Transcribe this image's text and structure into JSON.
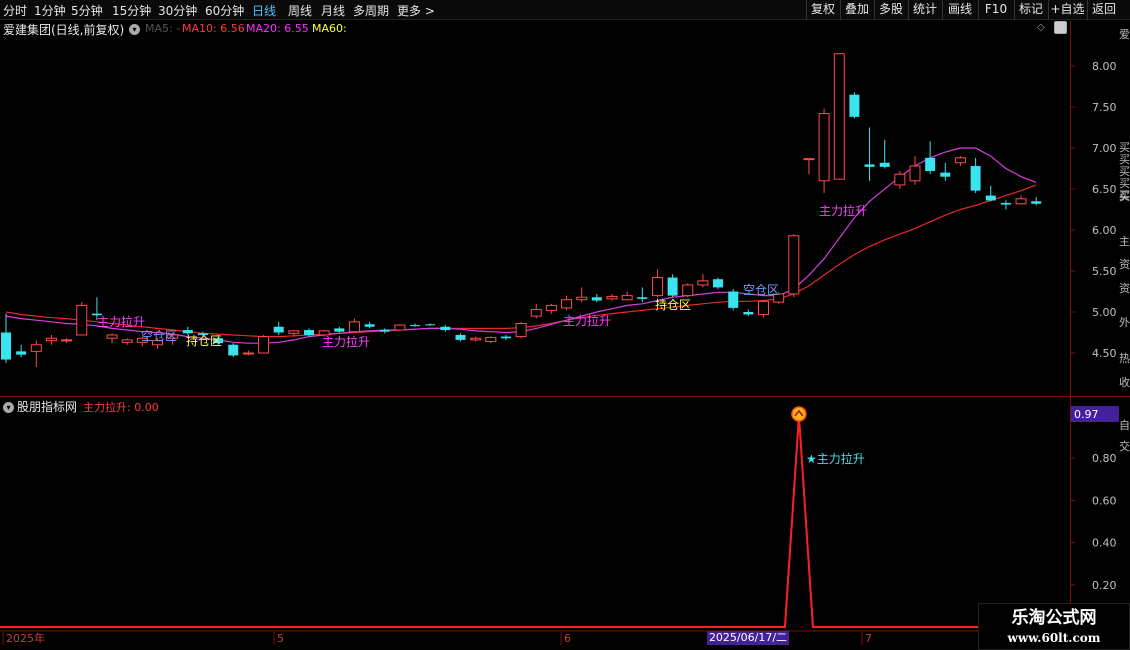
{
  "toolbar": {
    "timeframes": [
      "分时",
      "1分钟",
      "5分钟",
      "15分钟",
      "30分钟",
      "60分钟",
      "日线",
      "周线",
      "月线",
      "多周期",
      "更多 >"
    ],
    "active": "日线",
    "right_buttons": [
      "复权",
      "叠加",
      "多股",
      "统计",
      "画线",
      "F10",
      "标记",
      "+自选",
      "返回"
    ]
  },
  "main_header": {
    "stock_title": "爱建集团(日线,前复权)",
    "ma5": "MA5: -",
    "ma10": "MA10: 6.56",
    "ma20": "MA20: 6.55",
    "ma60": "MA60:",
    "colors": {
      "ma5": "#555555",
      "ma10": "#ff3a3a",
      "ma20": "#ff2bff",
      "ma60": "#ffff33"
    }
  },
  "indicator_header": {
    "name": "股朋指标网",
    "value": "主力拉升: 0.00"
  },
  "price_axis": [
    "8.00",
    "7.50",
    "7.00",
    "6.50",
    "6.00",
    "5.50",
    "5.00",
    "4.50"
  ],
  "indicator_axis": [
    "1.00",
    "0.80",
    "0.60",
    "0.40",
    "0.20"
  ],
  "indicator_current": "0.97",
  "time_axis": [
    "2025年",
    "5",
    "6",
    "7"
  ],
  "cursor_date": "2025/06/17/二",
  "chart_labels": {
    "lift": "主力拉升",
    "empty": "空仓区",
    "hold": "持仓区",
    "lift_star": "★主力拉升"
  },
  "side_strip": [
    "爱",
    "买买买买买",
    "买",
    "主",
    "资",
    "资",
    "外",
    "热",
    "收",
    "自",
    "交"
  ],
  "watermark": {
    "title": "乐淘公式网",
    "url": "www.60lt.com"
  },
  "chart_data": {
    "type": "candlestick",
    "ylim": [
      4.2,
      8.4
    ],
    "candles": [
      {
        "o": 4.75,
        "h": 4.98,
        "l": 4.38,
        "c": 4.42
      },
      {
        "o": 4.52,
        "h": 4.6,
        "l": 4.45,
        "c": 4.48
      },
      {
        "o": 4.52,
        "h": 4.65,
        "l": 4.33,
        "c": 4.6
      },
      {
        "o": 4.65,
        "h": 4.72,
        "l": 4.6,
        "c": 4.68
      },
      {
        "o": 4.65,
        "h": 4.68,
        "l": 4.62,
        "c": 4.66
      },
      {
        "o": 4.72,
        "h": 5.12,
        "l": 4.72,
        "c": 5.08
      },
      {
        "o": 4.98,
        "h": 5.18,
        "l": 4.9,
        "c": 4.96
      },
      {
        "o": 4.68,
        "h": 4.74,
        "l": 4.62,
        "c": 4.72
      },
      {
        "o": 4.63,
        "h": 4.68,
        "l": 4.6,
        "c": 4.66
      },
      {
        "o": 4.63,
        "h": 4.7,
        "l": 4.58,
        "c": 4.68
      },
      {
        "o": 4.6,
        "h": 4.68,
        "l": 4.55,
        "c": 4.65
      },
      {
        "o": 4.68,
        "h": 4.75,
        "l": 4.6,
        "c": 4.72
      },
      {
        "o": 4.78,
        "h": 4.82,
        "l": 4.72,
        "c": 4.74
      },
      {
        "o": 4.74,
        "h": 4.76,
        "l": 4.7,
        "c": 4.72
      },
      {
        "o": 4.68,
        "h": 4.72,
        "l": 4.6,
        "c": 4.62
      },
      {
        "o": 4.6,
        "h": 4.62,
        "l": 4.45,
        "c": 4.47
      },
      {
        "o": 4.5,
        "h": 4.53,
        "l": 4.47,
        "c": 4.5
      },
      {
        "o": 4.5,
        "h": 4.72,
        "l": 4.5,
        "c": 4.7
      },
      {
        "o": 4.82,
        "h": 4.88,
        "l": 4.72,
        "c": 4.75
      },
      {
        "o": 4.74,
        "h": 4.78,
        "l": 4.7,
        "c": 4.77
      },
      {
        "o": 4.78,
        "h": 4.8,
        "l": 4.7,
        "c": 4.72
      },
      {
        "o": 4.72,
        "h": 4.78,
        "l": 4.7,
        "c": 4.77
      },
      {
        "o": 4.8,
        "h": 4.82,
        "l": 4.75,
        "c": 4.76
      },
      {
        "o": 4.76,
        "h": 4.92,
        "l": 4.75,
        "c": 4.88
      },
      {
        "o": 4.85,
        "h": 4.88,
        "l": 4.8,
        "c": 4.82
      },
      {
        "o": 4.78,
        "h": 4.8,
        "l": 4.74,
        "c": 4.76
      },
      {
        "o": 4.78,
        "h": 4.85,
        "l": 4.78,
        "c": 4.84
      },
      {
        "o": 4.84,
        "h": 4.86,
        "l": 4.82,
        "c": 4.83
      },
      {
        "o": 4.85,
        "h": 4.86,
        "l": 4.83,
        "c": 4.84
      },
      {
        "o": 4.82,
        "h": 4.84,
        "l": 4.76,
        "c": 4.78
      },
      {
        "o": 4.72,
        "h": 4.74,
        "l": 4.64,
        "c": 4.66
      },
      {
        "o": 4.66,
        "h": 4.7,
        "l": 4.64,
        "c": 4.68
      },
      {
        "o": 4.64,
        "h": 4.7,
        "l": 4.62,
        "c": 4.69
      },
      {
        "o": 4.7,
        "h": 4.72,
        "l": 4.66,
        "c": 4.68
      },
      {
        "o": 4.7,
        "h": 4.88,
        "l": 4.68,
        "c": 4.86
      },
      {
        "o": 4.95,
        "h": 5.1,
        "l": 4.92,
        "c": 5.03
      },
      {
        "o": 5.02,
        "h": 5.1,
        "l": 4.98,
        "c": 5.08
      },
      {
        "o": 5.05,
        "h": 5.2,
        "l": 5.02,
        "c": 5.15
      },
      {
        "o": 5.15,
        "h": 5.3,
        "l": 5.12,
        "c": 5.18
      },
      {
        "o": 5.18,
        "h": 5.22,
        "l": 5.12,
        "c": 5.14
      },
      {
        "o": 5.16,
        "h": 5.22,
        "l": 5.14,
        "c": 5.19
      },
      {
        "o": 5.15,
        "h": 5.25,
        "l": 5.14,
        "c": 5.2
      },
      {
        "o": 5.18,
        "h": 5.3,
        "l": 5.12,
        "c": 5.16
      },
      {
        "o": 5.2,
        "h": 5.52,
        "l": 5.18,
        "c": 5.42
      },
      {
        "o": 5.42,
        "h": 5.46,
        "l": 5.18,
        "c": 5.2
      },
      {
        "o": 5.2,
        "h": 5.35,
        "l": 5.18,
        "c": 5.33
      },
      {
        "o": 5.33,
        "h": 5.46,
        "l": 5.3,
        "c": 5.38
      },
      {
        "o": 5.4,
        "h": 5.42,
        "l": 5.28,
        "c": 5.3
      },
      {
        "o": 5.25,
        "h": 5.28,
        "l": 5.02,
        "c": 5.05
      },
      {
        "o": 5.0,
        "h": 5.03,
        "l": 4.95,
        "c": 4.97
      },
      {
        "o": 4.97,
        "h": 5.15,
        "l": 4.93,
        "c": 5.13
      },
      {
        "o": 5.12,
        "h": 5.24,
        "l": 5.1,
        "c": 5.22
      },
      {
        "o": 5.22,
        "h": 5.95,
        "l": 5.18,
        "c": 5.93
      },
      {
        "o": 6.87,
        "h": 6.87,
        "l": 6.68,
        "c": 6.87
      },
      {
        "o": 6.6,
        "h": 7.48,
        "l": 6.45,
        "c": 7.42
      },
      {
        "o": 6.62,
        "h": 8.15,
        "l": 6.62,
        "c": 8.15
      },
      {
        "o": 7.65,
        "h": 7.68,
        "l": 7.36,
        "c": 7.38
      },
      {
        "o": 6.8,
        "h": 7.25,
        "l": 6.6,
        "c": 6.77
      },
      {
        "o": 6.82,
        "h": 7.1,
        "l": 6.75,
        "c": 6.77
      },
      {
        "o": 6.55,
        "h": 6.72,
        "l": 6.5,
        "c": 6.68
      },
      {
        "o": 6.6,
        "h": 6.9,
        "l": 6.55,
        "c": 6.78
      },
      {
        "o": 6.88,
        "h": 7.08,
        "l": 6.68,
        "c": 6.72
      },
      {
        "o": 6.7,
        "h": 6.82,
        "l": 6.6,
        "c": 6.65
      },
      {
        "o": 6.82,
        "h": 6.9,
        "l": 6.78,
        "c": 6.88
      },
      {
        "o": 6.78,
        "h": 6.88,
        "l": 6.45,
        "c": 6.48
      },
      {
        "o": 6.42,
        "h": 6.54,
        "l": 6.35,
        "c": 6.36
      },
      {
        "o": 6.33,
        "h": 6.36,
        "l": 6.25,
        "c": 6.31
      },
      {
        "o": 6.32,
        "h": 6.42,
        "l": 6.31,
        "c": 6.38
      },
      {
        "o": 6.35,
        "h": 6.4,
        "l": 6.3,
        "c": 6.32
      }
    ],
    "ma20": [
      4.95,
      4.92,
      4.9,
      4.88,
      4.86,
      4.85,
      4.83,
      4.8,
      4.78,
      4.76,
      4.75,
      4.73,
      4.7,
      4.68,
      4.66,
      4.63,
      4.62,
      4.62,
      4.63,
      4.66,
      4.7,
      4.72,
      4.74,
      4.76,
      4.77,
      4.78,
      4.78,
      4.79,
      4.8,
      4.8,
      4.79,
      4.77,
      4.76,
      4.75,
      4.76,
      4.8,
      4.85,
      4.9,
      4.95,
      5.0,
      5.04,
      5.08,
      5.1,
      5.14,
      5.18,
      5.2,
      5.22,
      5.24,
      5.24,
      5.22,
      5.2,
      5.2,
      5.28,
      5.45,
      5.65,
      5.9,
      6.15,
      6.35,
      6.5,
      6.65,
      6.78,
      6.88,
      6.95,
      7.0,
      7.0,
      6.9,
      6.75,
      6.65,
      6.58
    ],
    "ma10": [
      5.0,
      4.97,
      4.95,
      4.93,
      4.92,
      4.9,
      4.88,
      4.86,
      4.84,
      4.82,
      4.8,
      4.78,
      4.76,
      4.74,
      4.73,
      4.72,
      4.71,
      4.7,
      4.7,
      4.71,
      4.72,
      4.73,
      4.74,
      4.75,
      4.76,
      4.77,
      4.78,
      4.79,
      4.8,
      4.8,
      4.8,
      4.8,
      4.8,
      4.8,
      4.81,
      4.83,
      4.86,
      4.9,
      4.93,
      4.96,
      4.98,
      5.0,
      5.02,
      5.04,
      5.06,
      5.08,
      5.1,
      5.12,
      5.13,
      5.13,
      5.14,
      5.16,
      5.22,
      5.32,
      5.45,
      5.58,
      5.7,
      5.8,
      5.88,
      5.95,
      6.02,
      6.1,
      6.18,
      6.25,
      6.3,
      6.36,
      6.42,
      6.48,
      6.55
    ],
    "indicator": {
      "values_nonzero": [
        {
          "index": 53,
          "value": 1.0
        }
      ],
      "ylim": [
        0,
        1.05
      ]
    }
  }
}
